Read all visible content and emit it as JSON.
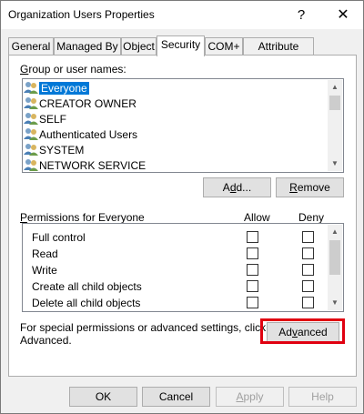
{
  "window": {
    "title": "Organization Users Properties",
    "help_glyph": "?",
    "close_glyph": "✕"
  },
  "tabs": [
    {
      "label": "General"
    },
    {
      "label": "Managed By"
    },
    {
      "label": "Object"
    },
    {
      "label": "Security"
    },
    {
      "label": "COM+"
    },
    {
      "label": "Attribute Editor"
    }
  ],
  "security": {
    "group_label_prefix": "G",
    "group_label_rest": "roup or user names:",
    "users": [
      {
        "name": "Everyone",
        "selected": true
      },
      {
        "name": "CREATOR OWNER"
      },
      {
        "name": "SELF"
      },
      {
        "name": "Authenticated Users"
      },
      {
        "name": "SYSTEM"
      },
      {
        "name": "NETWORK SERVICE"
      }
    ],
    "add_button": {
      "prefix": "A",
      "ul": "d",
      "rest": "d..."
    },
    "remove_button": {
      "ul": "R",
      "rest": "emove"
    },
    "permissions_label_ul": "P",
    "permissions_label_rest": "ermissions for Everyone",
    "allow_header": "Allow",
    "deny_header": "Deny",
    "permissions": [
      {
        "name": "Full control"
      },
      {
        "name": "Read"
      },
      {
        "name": "Write"
      },
      {
        "name": "Create all child objects"
      },
      {
        "name": "Delete all child objects"
      }
    ],
    "special_text_line1": "For special permissions or advanced settings, click",
    "special_text_line2": "Advanced.",
    "advanced_button": {
      "prefix": "Ad",
      "ul": "v",
      "rest": "anced"
    }
  },
  "footer": {
    "ok": "OK",
    "cancel": "Cancel",
    "apply_ul": "A",
    "apply_rest": "pply",
    "help": "Help"
  },
  "colors": {
    "selection": "#0078d7",
    "highlight_box": "#e00010"
  }
}
